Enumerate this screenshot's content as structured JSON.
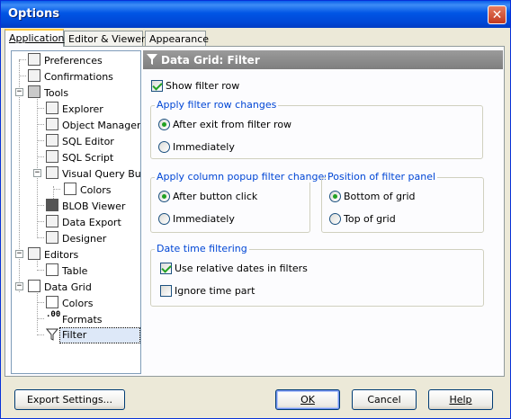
{
  "window": {
    "title": "Options",
    "close_glyph": "✕"
  },
  "tabs": [
    {
      "label": "Application",
      "active": true
    },
    {
      "label": "Editor & Viewers",
      "active": false
    },
    {
      "label": "Appearance",
      "active": false
    }
  ],
  "tree": [
    {
      "label": "Preferences",
      "icon": "preferences-icon"
    },
    {
      "label": "Confirmations",
      "icon": "confirmations-icon"
    },
    {
      "label": "Tools",
      "icon": "tools-icon",
      "expander": "−"
    },
    {
      "label": "Explorer",
      "icon": "explorer-icon"
    },
    {
      "label": "Object Manager",
      "icon": "object-manager-icon"
    },
    {
      "label": "SQL Editor",
      "icon": "sql-editor-icon"
    },
    {
      "label": "SQL Script",
      "icon": "sql-script-icon"
    },
    {
      "label": "Visual Query Builder",
      "icon": "visual-query-builder-icon",
      "expander": "−"
    },
    {
      "label": "Colors",
      "icon": "colors-icon"
    },
    {
      "label": "BLOB Viewer",
      "icon": "blob-viewer-icon"
    },
    {
      "label": "Data Export",
      "icon": "data-export-icon"
    },
    {
      "label": "Designer",
      "icon": "designer-icon"
    },
    {
      "label": "Editors",
      "icon": "editors-icon",
      "expander": "−"
    },
    {
      "label": "Table",
      "icon": "table-icon"
    },
    {
      "label": "Data Grid",
      "icon": "data-grid-icon",
      "expander": "−"
    },
    {
      "label": "Colors",
      "icon": "colors-icon"
    },
    {
      "label": "Formats",
      "icon": "formats-icon"
    },
    {
      "label": "Filter",
      "icon": "filter-icon",
      "selected": true
    }
  ],
  "panel": {
    "title": "Data Grid: Filter",
    "show_filter_row": {
      "label": "Show filter row",
      "checked": true
    },
    "apply_filter_row": {
      "title": "Apply filter row changes",
      "options": [
        {
          "label": "After exit from filter row",
          "checked": true
        },
        {
          "label": "Immediately",
          "checked": false
        }
      ]
    },
    "apply_column_popup": {
      "title": "Apply column popup filter changes",
      "options": [
        {
          "label": "After button click",
          "checked": true
        },
        {
          "label": "Immediately",
          "checked": false
        }
      ]
    },
    "position_filter_panel": {
      "title": "Position of filter panel",
      "options": [
        {
          "label": "Bottom of grid",
          "checked": true
        },
        {
          "label": "Top of grid",
          "checked": false
        }
      ]
    },
    "date_time_filtering": {
      "title": "Date time filtering",
      "use_relative_dates": {
        "label": "Use relative dates in filters",
        "checked": true
      },
      "ignore_time_part": {
        "label": "Ignore time part",
        "checked": false
      }
    }
  },
  "buttons": {
    "export": "Export Settings...",
    "ok": "OK",
    "cancel": "Cancel",
    "help": "Help"
  }
}
